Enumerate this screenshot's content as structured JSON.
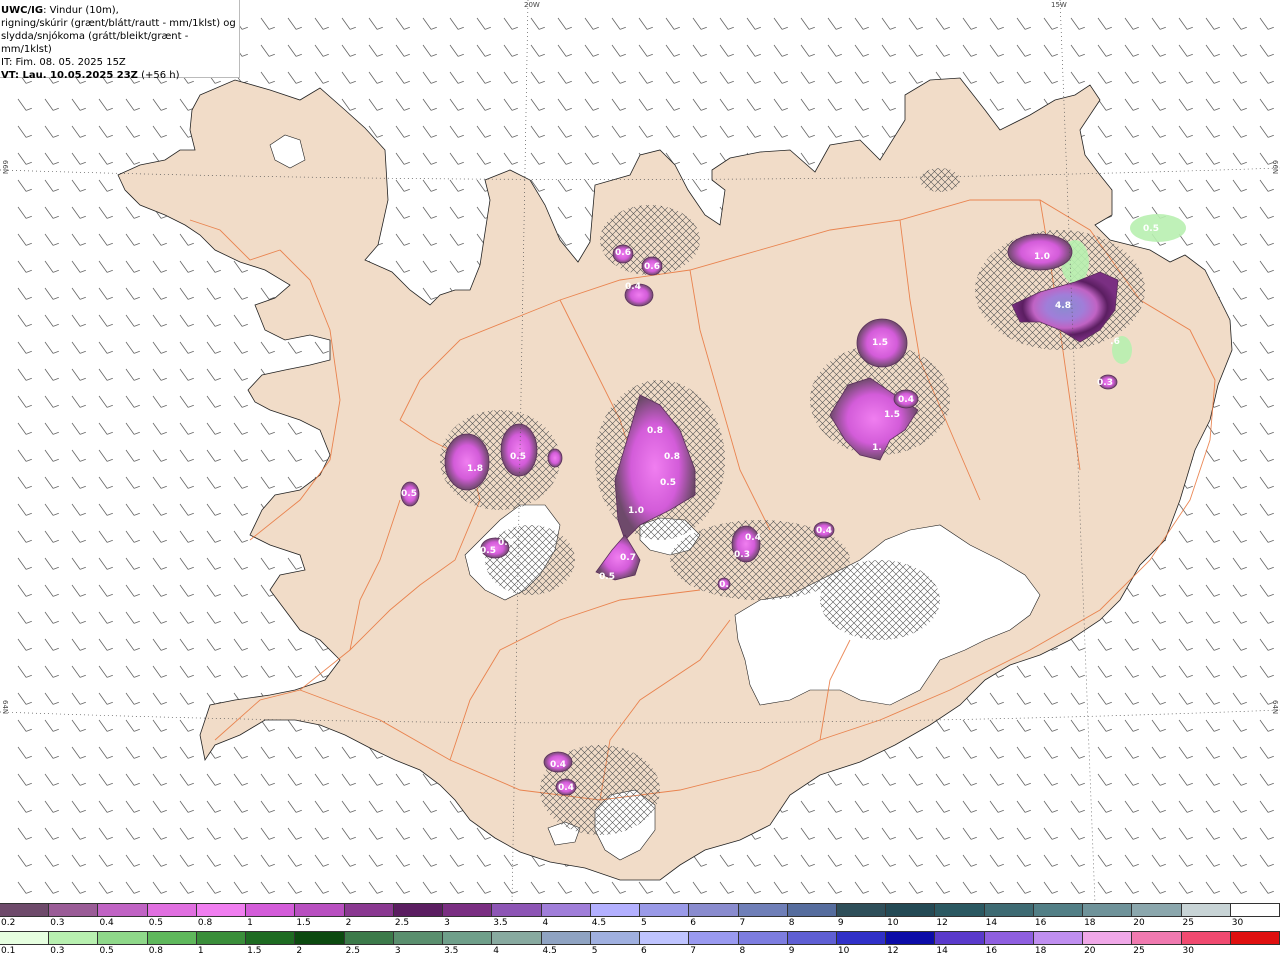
{
  "header": {
    "model": "UWC/IG",
    "title_rest": ": Vindur (10m),",
    "line2": "rigning/skúrir (grænt/blátt/rautt - mm/1klst) og",
    "line3": "slydda/snjókoma (grátt/bleikt/grænt - mm/1klst)",
    "line4": "IT: Fim. 08. 05. 2025 15Z",
    "vt_label": "VT: Lau. 10.05.2025 23Z",
    "vt_offset": " (+56 h)"
  },
  "grid_labels": {
    "lon1": "20W",
    "lon2": "15W",
    "lat_top": "66N",
    "lat_bottom": "64N"
  },
  "precip_labels": [
    {
      "text": "0.5",
      "type": "rain"
    },
    {
      "text": "1.0",
      "type": "snow"
    },
    {
      "text": "4.8",
      "type": "snow"
    },
    {
      "text": ".6",
      "type": "snow"
    },
    {
      "text": "0.3",
      "type": "snow"
    },
    {
      "text": "0.6",
      "type": "snow"
    },
    {
      "text": "0.6",
      "type": "snow"
    },
    {
      "text": "0.4",
      "type": "snow"
    },
    {
      "text": "1.5",
      "type": "snow"
    },
    {
      "text": "0.4",
      "type": "snow"
    },
    {
      "text": "1.5",
      "type": "snow"
    },
    {
      "text": "1.",
      "type": "snow"
    },
    {
      "text": "0.8",
      "type": "snow"
    },
    {
      "text": "0.8",
      "type": "snow"
    },
    {
      "text": "0.5",
      "type": "snow"
    },
    {
      "text": "1.0",
      "type": "snow"
    },
    {
      "text": "0.7",
      "type": "snow"
    },
    {
      "text": "0.5",
      "type": "snow"
    },
    {
      "text": "1.8",
      "type": "snow"
    },
    {
      "text": "0.5",
      "type": "snow"
    },
    {
      "text": "0.5",
      "type": "snow"
    },
    {
      "text": "0.5",
      "type": "snow"
    },
    {
      "text": "0.0",
      "type": "snow"
    },
    {
      "text": "0.4",
      "type": "snow"
    },
    {
      "text": "0.3",
      "type": "snow"
    },
    {
      "text": "0.",
      "type": "snow"
    },
    {
      "text": "0.4",
      "type": "snow"
    },
    {
      "text": "0.4",
      "type": "snow"
    },
    {
      "text": "0.4",
      "type": "snow"
    }
  ],
  "scale_snow": {
    "colors": [
      "#6e4a6b",
      "#9a5c97",
      "#c063c4",
      "#e06fe0",
      "#f07ef0",
      "#d35cd9",
      "#b84fc0",
      "#8a3891",
      "#5b1e61",
      "#7a2f82",
      "#8d55b5",
      "#a07ed9",
      "#b3b0ff",
      "#9a9ae8",
      "#8a8ccf",
      "#6f7fb8",
      "#566d9e",
      "#2f4f5a",
      "#244a55",
      "#2b5962",
      "#3e6b73",
      "#527f86",
      "#6f939a",
      "#8ba7ad",
      "#c8d4d6",
      "#ffffff"
    ],
    "labels": [
      "0.2",
      "0.3",
      "0.4",
      "0.5",
      "0.8",
      "1",
      "1.5",
      "2",
      "2.5",
      "3",
      "3.5",
      "4",
      "4.5",
      "5",
      "6",
      "7",
      "8",
      "9",
      "10",
      "12",
      "14",
      "16",
      "18",
      "20",
      "25",
      "30"
    ]
  },
  "scale_rain": {
    "colors": [
      "#e6ffe0",
      "#b8f0b0",
      "#8fd88a",
      "#5fb85c",
      "#3a8e3a",
      "#1e6b22",
      "#0c4a10",
      "#3c7a4a",
      "#5a8f6e",
      "#6f9f8a",
      "#88aaa0",
      "#8fa3c2",
      "#a0b0e0",
      "#bfc4ff",
      "#9a9af0",
      "#7d7de0",
      "#5f5fd4",
      "#3030c8",
      "#0c0ca8",
      "#5a3acb",
      "#8f5fe0",
      "#c08ff0",
      "#f0a8e8",
      "#f07ab0",
      "#f04a70",
      "#e01010"
    ],
    "labels": [
      "0.1",
      "0.3",
      "0.5",
      "0.8",
      "1",
      "1.5",
      "2",
      "2.5",
      "3",
      "3.5",
      "4",
      "4.5",
      "5",
      "6",
      "7",
      "8",
      "9",
      "10",
      "12",
      "14",
      "16",
      "18",
      "20",
      "25",
      "30"
    ]
  }
}
